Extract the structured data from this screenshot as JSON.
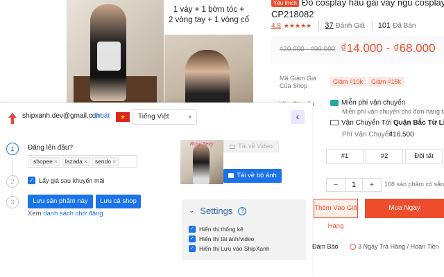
{
  "product_page": {
    "caption_lines": [
      "1 váy + 1 bờm tóc +",
      "2 vòng tay + 1 vòng cổ"
    ],
    "thumb_overlay_text": "Rosy Sexy",
    "title_tag": "Yêu thích",
    "title_line1": "Đồ cosplay hầu gái váy ngủ cosplay",
    "title_line2": "CP218082",
    "rating_value": "4.8",
    "stars": "★★★★★",
    "reviews_count": "37",
    "reviews_label": "Đánh Giá",
    "sold_count": "101",
    "sold_label": "Đã Bán",
    "price_old": "₫20.000 - ₫99.000",
    "price_new": "₫14.000 - ₫68.000",
    "voucher_label": "Mã Giảm Giá Của Shop",
    "vouchers": [
      "Giảm ₫10k",
      "Giảm ₫15k"
    ],
    "shipping_label": "Vận Chuyển",
    "freeship_title": "Miễn phí vận chuyển",
    "freeship_sub": "Miễn phí vận chuyển cho đơn hàng trên",
    "ship_to_label": "Vận Chuyển Tới",
    "ship_to_value": "Quận Bắc Từ Liêm",
    "ship_fee_label": "Phí Vận Chuyển",
    "ship_fee_value": "₫16.500",
    "options": [
      "#1",
      "#2",
      "Đôi tất"
    ],
    "qty_minus": "−",
    "qty_value": "1",
    "qty_plus": "+",
    "stock_text": "108 sản phẩm có sẵn",
    "add_to_cart": "Thêm Vào Giỏ Hàng",
    "buy_now": "Mua Ngay",
    "guarantee": "Đảm Bảo",
    "returns": "3 Ngày Trả Hàng / Hoàn Tiền"
  },
  "extension": {
    "email": "shipxanh.dev@gmail.com",
    "logout": "thoát",
    "flag_star": "★",
    "language": "Tiếng Việt",
    "collapse_glyph": "‹",
    "steps": [
      "1",
      "2",
      "3"
    ],
    "step1_label": "Đăng lên đâu?",
    "platforms": [
      "shopee",
      "lazada",
      "sendo"
    ],
    "promo_checkbox_label": "Lấy giá sau khuyến mãi",
    "save_product": "Lưu sản phẩm này",
    "save_shop": "Lưu cả shop",
    "view_prefix": "Xem",
    "view_link": "danh sách chờ đăng",
    "download_video": "Tải về Video",
    "download_album": "Tải về bộ ảnh",
    "settings_title": "Settings",
    "settings_items": [
      "Hiển thị thống kê",
      "Hiển thị tải ảnh/video",
      "Hiển thị Lưu vào ShipXanh"
    ],
    "colors": {
      "primary": "#1a73e8",
      "shopee_orange": "#ee4d2d",
      "accent_purple": "#5b2bd9"
    }
  }
}
